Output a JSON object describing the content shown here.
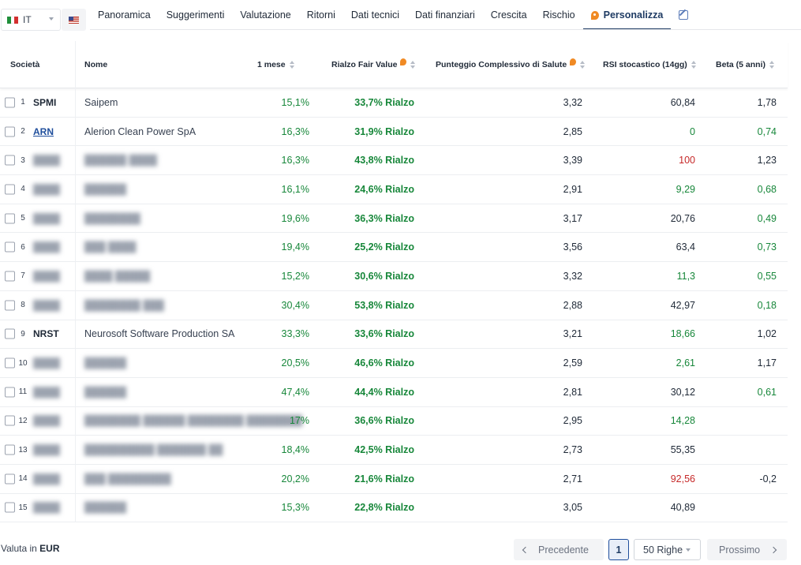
{
  "country": {
    "code": "IT",
    "flag_colors": [
      "#1f8f3a",
      "#ffffff",
      "#d32f2f"
    ]
  },
  "tabs": [
    {
      "label": "Panoramica",
      "active": false
    },
    {
      "label": "Suggerimenti",
      "active": false
    },
    {
      "label": "Valutazione",
      "active": false
    },
    {
      "label": "Ritorni",
      "active": false
    },
    {
      "label": "Dati tecnici",
      "active": false
    },
    {
      "label": "Dati finanziari",
      "active": false
    },
    {
      "label": "Crescita",
      "active": false
    },
    {
      "label": "Rischio",
      "active": false
    },
    {
      "label": "Personalizza",
      "active": true
    }
  ],
  "columns": {
    "company": "Società",
    "name": "Nome",
    "month1": "1 mese",
    "fair_value": "Rialzo Fair Value",
    "health": "Punteggio Complessivo di Salute",
    "rsi": "RSI stocastico (14gg)",
    "beta": "Beta (5 anni)"
  },
  "rows": [
    {
      "num": "1",
      "ticker": "SPMI",
      "name": "Saipem",
      "month1": "15,1%",
      "fair_value": "33,7% Rialzo",
      "health": "3,32",
      "rsi": "60,84",
      "rsi_color": "dark",
      "beta": "1,78",
      "beta_color": "dark"
    },
    {
      "num": "2",
      "ticker": "ARN",
      "ticker_link": true,
      "name": "Alerion Clean Power SpA",
      "month1": "16,3%",
      "fair_value": "31,9% Rialzo",
      "health": "2,85",
      "rsi": "0",
      "rsi_color": "green",
      "beta": "0,74",
      "beta_color": "green"
    },
    {
      "num": "3",
      "ticker": "████",
      "hidden": true,
      "name": "██████ ████",
      "month1": "16,3%",
      "fair_value": "43,8% Rialzo",
      "health": "3,39",
      "rsi": "100",
      "rsi_color": "red",
      "beta": "1,23",
      "beta_color": "dark"
    },
    {
      "num": "4",
      "ticker": "████",
      "hidden": true,
      "name": "██████",
      "month1": "16,1%",
      "fair_value": "24,6% Rialzo",
      "health": "2,91",
      "rsi": "9,29",
      "rsi_color": "green",
      "beta": "0,68",
      "beta_color": "green"
    },
    {
      "num": "5",
      "ticker": "████",
      "hidden": true,
      "name": "████████",
      "month1": "19,6%",
      "fair_value": "36,3% Rialzo",
      "health": "3,17",
      "rsi": "20,76",
      "rsi_color": "dark",
      "beta": "0,49",
      "beta_color": "green"
    },
    {
      "num": "6",
      "ticker": "████",
      "hidden": true,
      "name": "███ ████",
      "month1": "19,4%",
      "fair_value": "25,2% Rialzo",
      "health": "3,56",
      "rsi": "63,4",
      "rsi_color": "dark",
      "beta": "0,73",
      "beta_color": "green"
    },
    {
      "num": "7",
      "ticker": "████",
      "hidden": true,
      "name": "████ █████",
      "month1": "15,2%",
      "fair_value": "30,6% Rialzo",
      "health": "3,32",
      "rsi": "11,3",
      "rsi_color": "green",
      "beta": "0,55",
      "beta_color": "green"
    },
    {
      "num": "8",
      "ticker": "████",
      "hidden": true,
      "name": "████████ ███",
      "month1": "30,4%",
      "fair_value": "53,8% Rialzo",
      "health": "2,88",
      "rsi": "42,97",
      "rsi_color": "dark",
      "beta": "0,18",
      "beta_color": "green"
    },
    {
      "num": "9",
      "ticker": "NRST",
      "name": "Neurosoft Software Production SA",
      "month1": "33,3%",
      "fair_value": "33,6% Rialzo",
      "health": "3,21",
      "rsi": "18,66",
      "rsi_color": "green",
      "beta": "1,02",
      "beta_color": "dark"
    },
    {
      "num": "10",
      "ticker": "████",
      "hidden": true,
      "name": "██████",
      "month1": "20,5%",
      "fair_value": "46,6% Rialzo",
      "health": "2,59",
      "rsi": "2,61",
      "rsi_color": "green",
      "beta": "1,17",
      "beta_color": "dark"
    },
    {
      "num": "11",
      "ticker": "████",
      "hidden": true,
      "name": "██████",
      "month1": "47,4%",
      "fair_value": "44,4% Rialzo",
      "health": "2,81",
      "rsi": "30,12",
      "rsi_color": "dark",
      "beta": "0,61",
      "beta_color": "green"
    },
    {
      "num": "12",
      "ticker": "████",
      "hidden": true,
      "name": "████████ ██████ ████████ ████████",
      "month1": "17%",
      "fair_value": "36,6% Rialzo",
      "health": "2,95",
      "rsi": "14,28",
      "rsi_color": "green",
      "beta": "",
      "beta_color": "dark"
    },
    {
      "num": "13",
      "ticker": "████",
      "hidden": true,
      "name": "██████████ ███████ ██",
      "month1": "18,4%",
      "fair_value": "42,5% Rialzo",
      "health": "2,73",
      "rsi": "55,35",
      "rsi_color": "dark",
      "beta": "",
      "beta_color": "dark"
    },
    {
      "num": "14",
      "ticker": "████",
      "hidden": true,
      "name": "███ █████████",
      "month1": "20,2%",
      "fair_value": "21,6% Rialzo",
      "health": "2,71",
      "rsi": "92,56",
      "rsi_color": "red",
      "beta": "-0,2",
      "beta_color": "dark"
    },
    {
      "num": "15",
      "ticker": "████",
      "hidden": true,
      "name": "██████",
      "month1": "15,3%",
      "fair_value": "22,8% Rialzo",
      "health": "3,05",
      "rsi": "40,89",
      "rsi_color": "dark",
      "beta": "",
      "beta_color": "dark"
    }
  ],
  "footer": {
    "currency_label": "Valuta in",
    "currency": "EUR",
    "prev": "Precedente",
    "page": "1",
    "rows_per_page": "50 Righe",
    "next": "Prossimo"
  }
}
